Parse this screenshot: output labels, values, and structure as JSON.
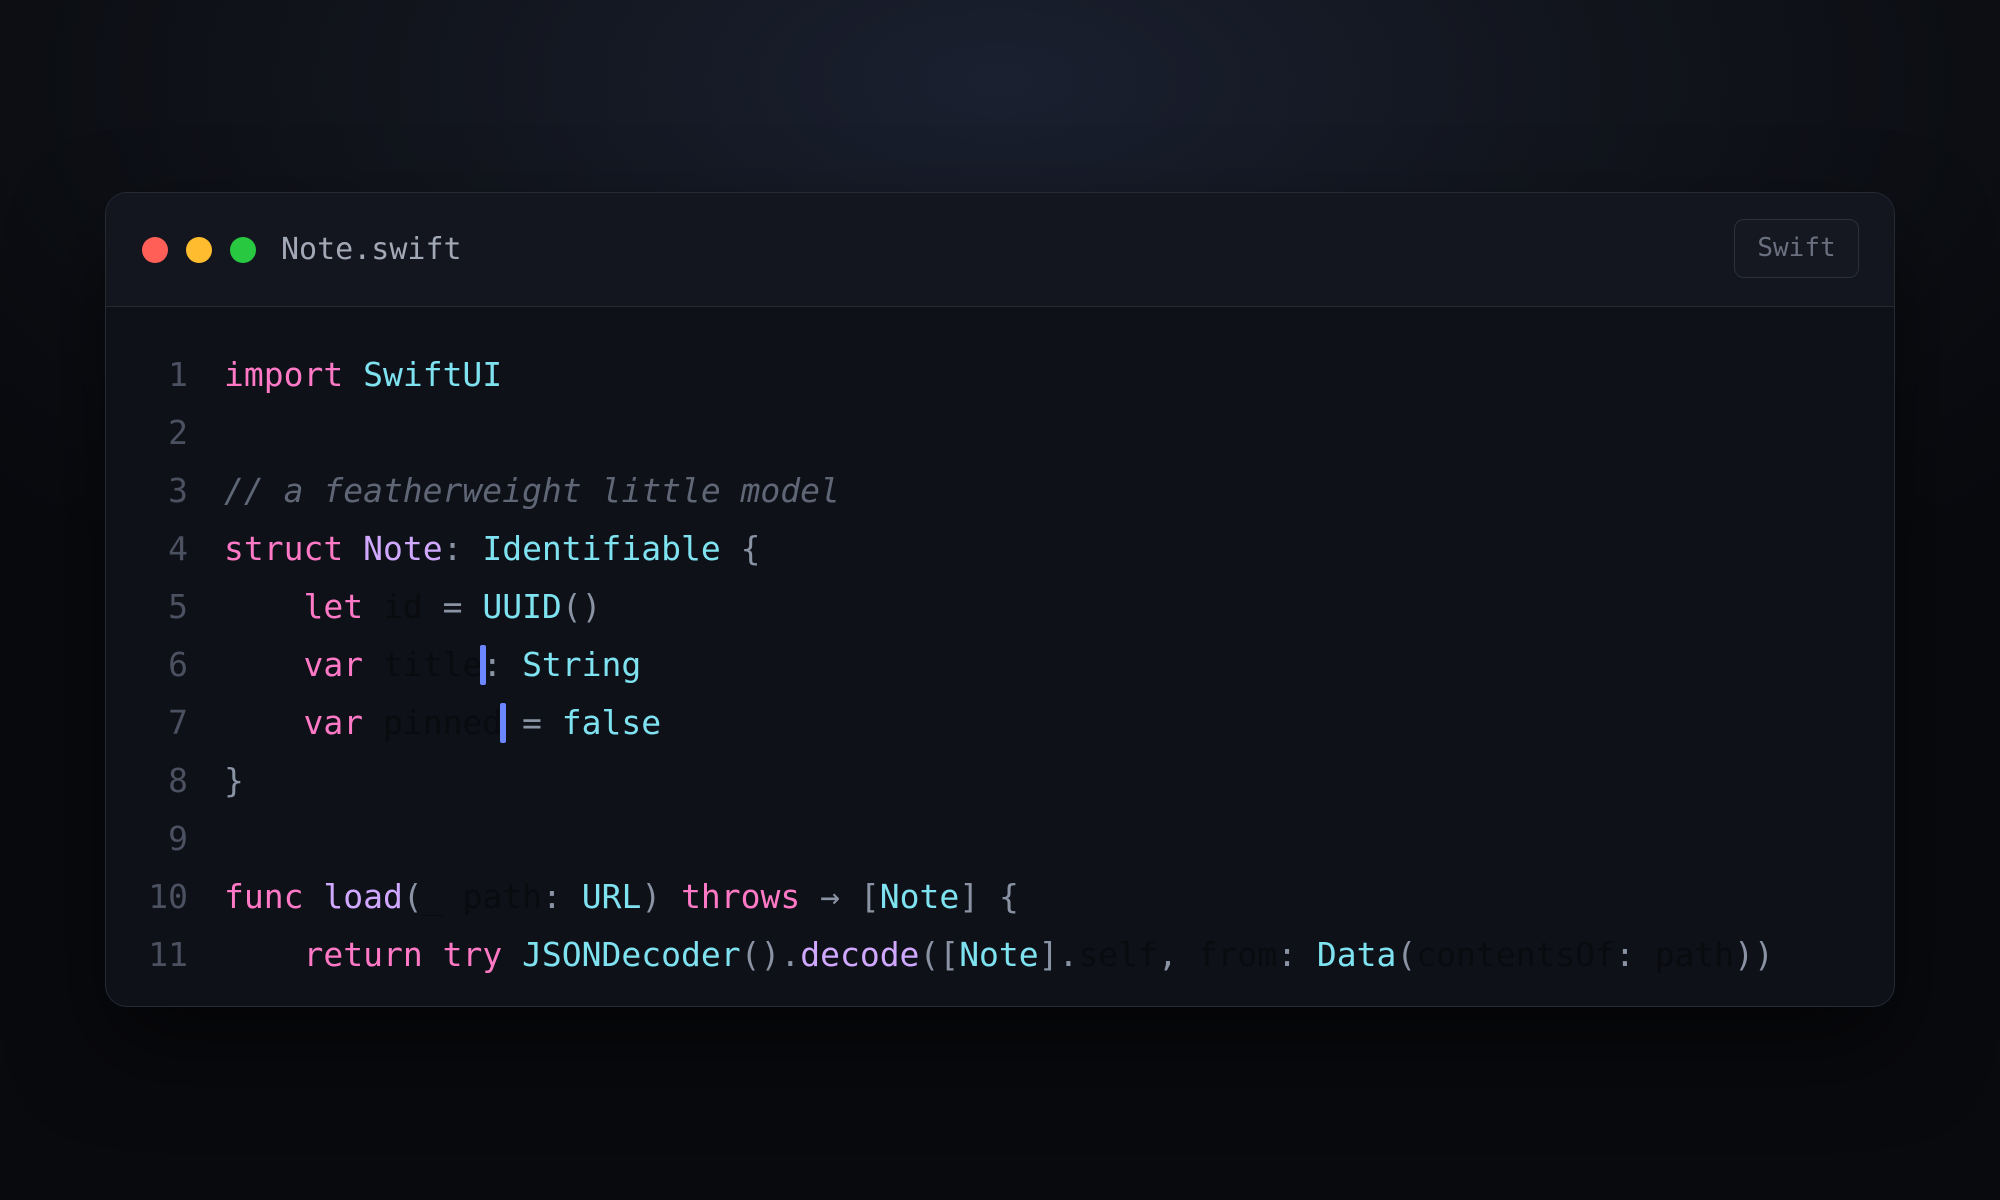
{
  "window": {
    "filename": "Note.swift",
    "language_badge": "Swift"
  },
  "code": {
    "lines": [
      {
        "num": "1",
        "tokens": [
          {
            "t": "import",
            "c": "kw"
          },
          {
            "t": " ",
            "c": "p"
          },
          {
            "t": "SwiftUI",
            "c": "ty"
          }
        ]
      },
      {
        "num": "2",
        "tokens": []
      },
      {
        "num": "3",
        "tokens": [
          {
            "t": "// a featherweight little model",
            "c": "cm"
          }
        ]
      },
      {
        "num": "4",
        "tokens": [
          {
            "t": "struct",
            "c": "kw"
          },
          {
            "t": " ",
            "c": "p"
          },
          {
            "t": "Note",
            "c": "fn"
          },
          {
            "t": ": ",
            "c": "p"
          },
          {
            "t": "Identifiable",
            "c": "ty"
          },
          {
            "t": " {",
            "c": "p"
          }
        ]
      },
      {
        "num": "5",
        "tokens": [
          {
            "t": "    ",
            "c": "p"
          },
          {
            "t": "let",
            "c": "kw"
          },
          {
            "t": " ",
            "c": "p"
          },
          {
            "t": "id",
            "c": "ident"
          },
          {
            "t": " = ",
            "c": "p"
          },
          {
            "t": "UUID",
            "c": "ty"
          },
          {
            "t": "()",
            "c": "p"
          }
        ]
      },
      {
        "num": "6",
        "tokens": [
          {
            "t": "    ",
            "c": "p"
          },
          {
            "t": "var",
            "c": "kw"
          },
          {
            "t": " ",
            "c": "p"
          },
          {
            "t": "title",
            "c": "ident"
          },
          {
            "t": ": ",
            "c": "p"
          },
          {
            "t": "String",
            "c": "ty"
          }
        ]
      },
      {
        "num": "7",
        "tokens": [
          {
            "t": "    ",
            "c": "p"
          },
          {
            "t": "var",
            "c": "kw"
          },
          {
            "t": " ",
            "c": "p"
          },
          {
            "t": "pinned",
            "c": "ident"
          },
          {
            "t": " = ",
            "c": "p"
          },
          {
            "t": "false",
            "c": "ty"
          }
        ]
      },
      {
        "num": "8",
        "tokens": [
          {
            "t": "}",
            "c": "p"
          }
        ]
      },
      {
        "num": "9",
        "tokens": []
      },
      {
        "num": "10",
        "tokens": [
          {
            "t": "func",
            "c": "kw"
          },
          {
            "t": " ",
            "c": "p"
          },
          {
            "t": "load",
            "c": "fn"
          },
          {
            "t": "(",
            "c": "p"
          },
          {
            "t": "_",
            "c": "ident"
          },
          {
            "t": " ",
            "c": "p"
          },
          {
            "t": "path",
            "c": "ident"
          },
          {
            "t": ": ",
            "c": "p"
          },
          {
            "t": "URL",
            "c": "ty"
          },
          {
            "t": ") ",
            "c": "p"
          },
          {
            "t": "throws",
            "c": "kw"
          },
          {
            "t": " → [",
            "c": "p"
          },
          {
            "t": "Note",
            "c": "ty"
          },
          {
            "t": "] {",
            "c": "p"
          }
        ]
      },
      {
        "num": "11",
        "tokens": [
          {
            "t": "    ",
            "c": "p"
          },
          {
            "t": "return",
            "c": "kw"
          },
          {
            "t": " ",
            "c": "p"
          },
          {
            "t": "try",
            "c": "kw"
          },
          {
            "t": " ",
            "c": "p"
          },
          {
            "t": "JSONDecoder",
            "c": "ty"
          },
          {
            "t": "().",
            "c": "p"
          },
          {
            "t": "decode",
            "c": "fn"
          },
          {
            "t": "([",
            "c": "p"
          },
          {
            "t": "Note",
            "c": "ty"
          },
          {
            "t": "].",
            "c": "p"
          },
          {
            "t": "self",
            "c": "ident"
          },
          {
            "t": ", ",
            "c": "p"
          },
          {
            "t": "from",
            "c": "ident"
          },
          {
            "t": ": ",
            "c": "p"
          },
          {
            "t": "Data",
            "c": "ty"
          },
          {
            "t": "(",
            "c": "p"
          },
          {
            "t": "contentsOf",
            "c": "ident"
          },
          {
            "t": ": ",
            "c": "p"
          },
          {
            "t": "path",
            "c": "ident"
          },
          {
            "t": "))",
            "c": "p"
          }
        ]
      }
    ],
    "cursors": [
      {
        "line": 6,
        "after_column": 13
      },
      {
        "line": 7,
        "after_column": 14
      }
    ]
  },
  "colors": {
    "keyword": "#ff79c6",
    "type": "#7ee2f0",
    "declaration": "#d0a8ff",
    "punctuation": "#8a93a4",
    "comment": "#5f6676",
    "line_number": "#4b5160",
    "cursor": "#6b86ff",
    "background": "#0f1118"
  }
}
